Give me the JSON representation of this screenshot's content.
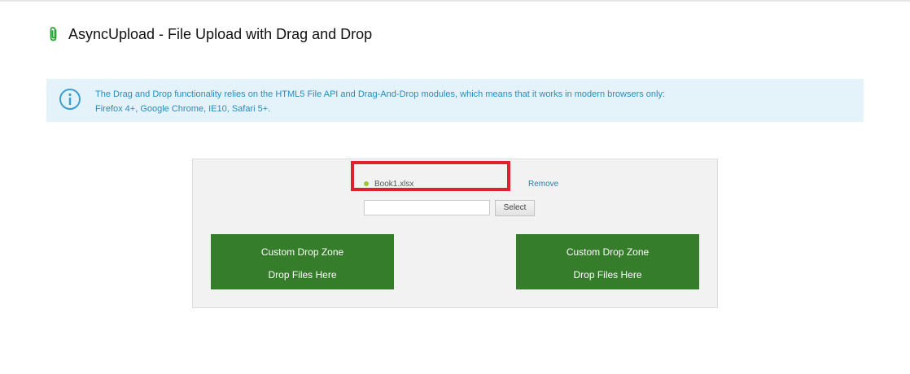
{
  "header": {
    "icon": "paperclip-icon",
    "title": "AsyncUpload - File Upload with Drag and Drop"
  },
  "info": {
    "icon": "info-circle-icon",
    "line1": "The Drag and Drop functionality relies on the HTML5 File API and Drag-And-Drop modules, which means that it works in modern browsers only:",
    "line2": "Firefox 4+, Google Chrome, IE10, Safari 5+."
  },
  "upload": {
    "file_name": "Book1.xlsx",
    "file_status_icon": "status-dot-icon",
    "remove_label": "Remove",
    "input_value": "",
    "select_label": "Select"
  },
  "drop_zones": [
    {
      "title": "Custom Drop Zone",
      "subtitle": "Drop Files Here"
    },
    {
      "title": "Custom Drop Zone",
      "subtitle": "Drop Files Here"
    }
  ],
  "colors": {
    "accent_green": "#367d2b",
    "info_bg": "#e4f3f9",
    "info_text": "#2a8bbb",
    "highlight_red": "#e0202a",
    "file_dot": "#a7c23a"
  }
}
